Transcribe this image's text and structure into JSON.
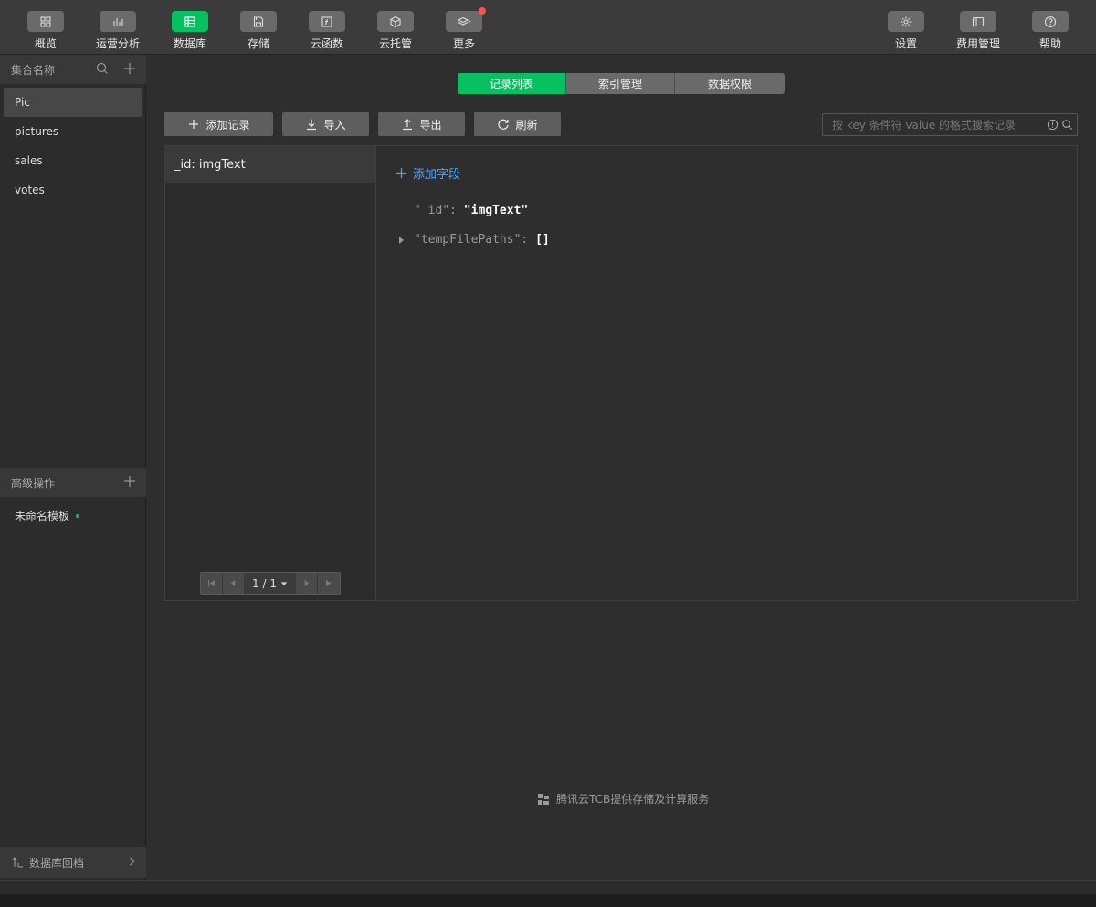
{
  "toolbar": {
    "left": [
      {
        "label": "概览",
        "icon": "grid-icon"
      },
      {
        "label": "运营分析",
        "icon": "bar-chart-icon"
      },
      {
        "label": "数据库",
        "icon": "database-icon"
      },
      {
        "label": "存储",
        "icon": "storage-icon"
      },
      {
        "label": "云函数",
        "icon": "function-icon"
      },
      {
        "label": "云托管",
        "icon": "cube-icon"
      },
      {
        "label": "更多",
        "icon": "layers-icon"
      }
    ],
    "right": [
      {
        "label": "设置",
        "icon": "gear-icon"
      },
      {
        "label": "费用管理",
        "icon": "billing-icon"
      },
      {
        "label": "帮助",
        "icon": "help-icon"
      }
    ]
  },
  "sidebar": {
    "collections_header": "集合名称",
    "collections": [
      "Pic",
      "pictures",
      "sales",
      "votes"
    ],
    "advanced_header": "高级操作",
    "template_item": "未命名模板",
    "footer": "数据库回档"
  },
  "tabs": [
    "记录列表",
    "索引管理",
    "数据权限"
  ],
  "actions": {
    "add_record": "添加记录",
    "import": "导入",
    "export": "导出",
    "refresh": "刷新"
  },
  "search": {
    "placeholder": "按 key 条件符 value 的格式搜索记录"
  },
  "records": [
    {
      "label": "_id: imgText"
    }
  ],
  "pager": {
    "page": "1 / 1"
  },
  "detail": {
    "add_field": "添加字段",
    "fields": [
      {
        "key": "\"_id\"",
        "colon": ": ",
        "value": "\"imgText\""
      },
      {
        "key": "\"tempFilePaths\"",
        "colon": ": ",
        "value": "[]"
      }
    ]
  },
  "footer_note": "腾讯云TCB提供存储及计算服务",
  "colors": {
    "accent": "#07c160",
    "link": "#4aa3ff",
    "notify": "#fa5151"
  }
}
